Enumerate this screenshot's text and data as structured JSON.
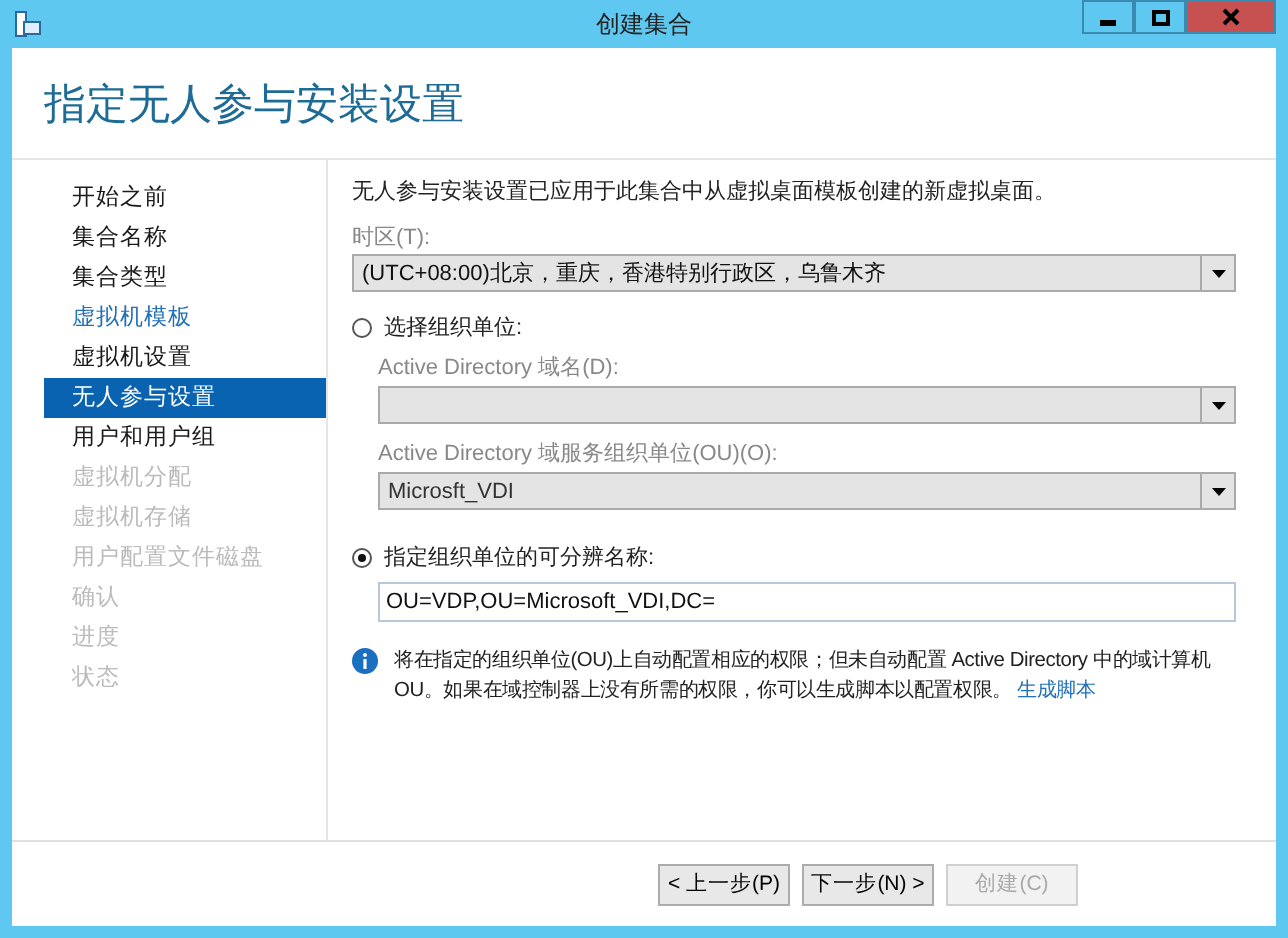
{
  "window": {
    "title": "创建集合"
  },
  "heading": "指定无人参与安装设置",
  "sidebar": {
    "items": [
      {
        "label": "开始之前",
        "link": false,
        "disabled": false,
        "selected": false
      },
      {
        "label": "集合名称",
        "link": false,
        "disabled": false,
        "selected": false
      },
      {
        "label": "集合类型",
        "link": false,
        "disabled": false,
        "selected": false
      },
      {
        "label": "虚拟机模板",
        "link": true,
        "disabled": false,
        "selected": false
      },
      {
        "label": "虚拟机设置",
        "link": false,
        "disabled": false,
        "selected": false
      },
      {
        "label": "无人参与设置",
        "link": false,
        "disabled": false,
        "selected": true
      },
      {
        "label": "用户和用户组",
        "link": false,
        "disabled": false,
        "selected": false
      },
      {
        "label": "虚拟机分配",
        "link": false,
        "disabled": true,
        "selected": false
      },
      {
        "label": "虚拟机存储",
        "link": false,
        "disabled": true,
        "selected": false
      },
      {
        "label": "用户配置文件磁盘",
        "link": false,
        "disabled": true,
        "selected": false
      },
      {
        "label": "确认",
        "link": false,
        "disabled": true,
        "selected": false
      },
      {
        "label": "进度",
        "link": false,
        "disabled": true,
        "selected": false
      },
      {
        "label": "状态",
        "link": false,
        "disabled": true,
        "selected": false
      }
    ]
  },
  "description": "无人参与安装设置已应用于此集合中从虚拟桌面模板创建的新虚拟桌面。",
  "timezone": {
    "label": "时区(T):",
    "value": "(UTC+08:00)北京，重庆，香港特别行政区，乌鲁木齐"
  },
  "options": [
    {
      "label": "选择组织单位:",
      "selected": false
    },
    {
      "label": "指定组织单位的可分辨名称:",
      "selected": true
    }
  ],
  "domain": {
    "label": "Active Directory 域名(D):",
    "disabled": true
  },
  "ou": {
    "label": "Active Directory 域服务组织单位(OU)(O):",
    "value": "Microsft_VDI",
    "disabled": true
  },
  "dn_field": {
    "value": "OU=VDP,OU=Microsoft_VDI,DC="
  },
  "info": {
    "text": "将在指定的组织单位(OU)上自动配置相应的权限；但未自动配置 Active Directory 中的域计算机 OU。如果在域控制器上没有所需的权限，你可以生成脚本以配置权限。",
    "link": "生成脚本"
  },
  "buttons": [
    {
      "label": "< 上一步(P)",
      "disabled": false
    },
    {
      "label": "下一步(N) >",
      "disabled": false
    },
    {
      "label": "创建(C)",
      "disabled": true
    }
  ]
}
